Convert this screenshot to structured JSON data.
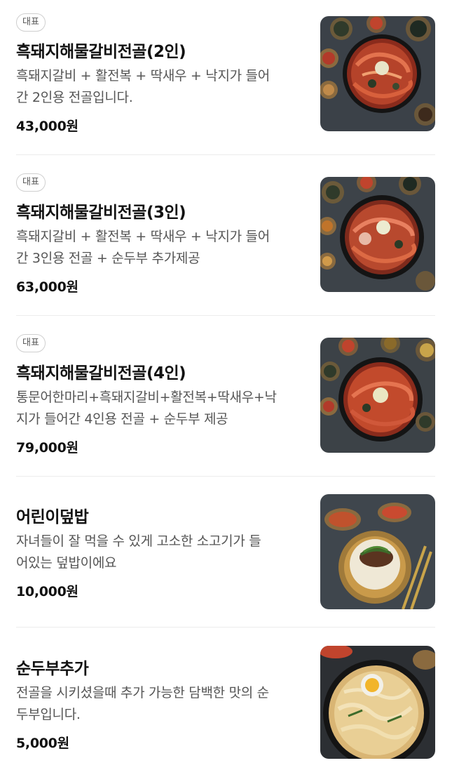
{
  "menu": {
    "items": [
      {
        "badge": "대표",
        "name": "흑돼지해물갈비전골(2인)",
        "desc_line1": "흑돼지갈비 + 활전복 + 딱새우 + 낙지가 들어",
        "desc_line2": "간 2인용 전골입니다.",
        "price": "43,000원",
        "photo": "seafood-galbi-jeongol-photo"
      },
      {
        "badge": "대표",
        "name": "흑돼지해물갈비전골(3인)",
        "desc_line1": "흑돼지갈비 + 활전복 + 딱새우 + 낙지가 들어",
        "desc_line2": "간 3인용 전골 + 순두부 추가제공",
        "price": "63,000원",
        "photo": "seafood-galbi-jeongol-photo"
      },
      {
        "badge": "대표",
        "name": "흑돼지해물갈비전골(4인)",
        "desc_line1": "통문어한마리+흑돼지갈비+활전복+딱새우+낙",
        "desc_line2": "지가 들어간 4인용 전골 + 순두부 제공",
        "price": "79,000원",
        "photo": "seafood-galbi-jeongol-photo"
      },
      {
        "name": "어린이덮밥",
        "desc_line1": "자녀들이 잘 먹을 수 있게 고소한 소고기가 들",
        "desc_line2": "어있는 덮밥이에요",
        "price": "10,000원",
        "photo": "beef-rice-bowl-photo"
      },
      {
        "name": "순두부추가",
        "desc_line1": "전골을 시키셨을때 추가 가능한 담백한 맛의 순",
        "desc_line2": "두부입니다.",
        "price": "5,000원",
        "photo": "soft-tofu-stew-photo"
      }
    ]
  }
}
